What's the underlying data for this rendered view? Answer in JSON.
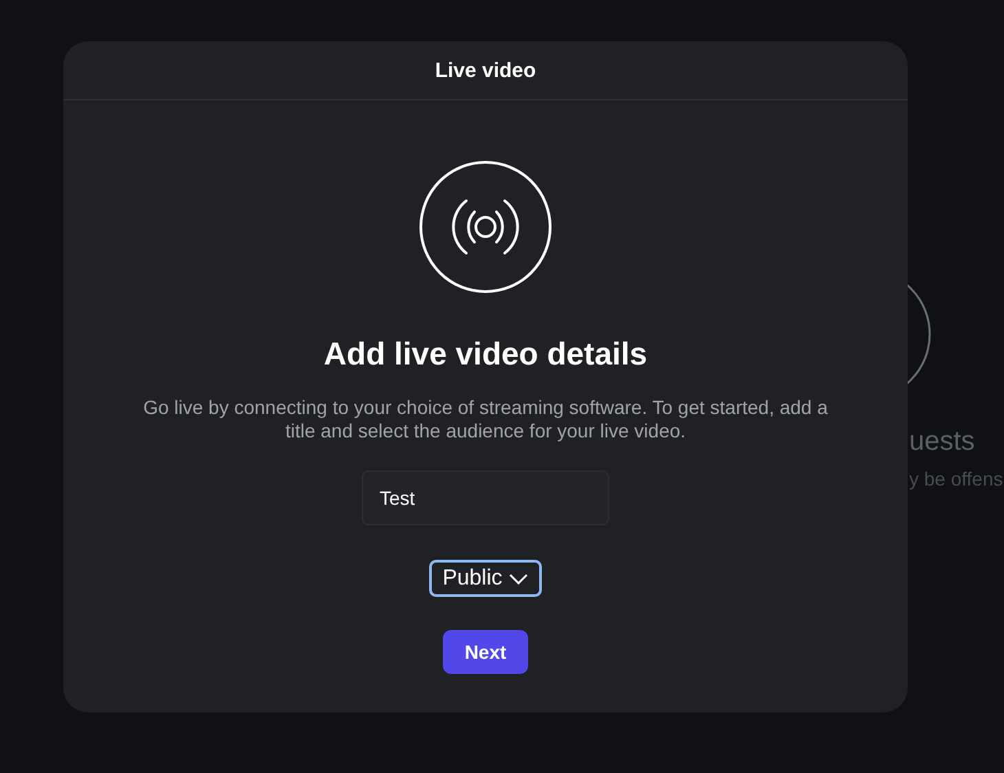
{
  "background": {
    "heading": "uests",
    "text": "y be offens"
  },
  "dialog": {
    "title": "Live video",
    "heading": "Add live video details",
    "description": "Go live by connecting to your choice of streaming software. To get started, add a title and select the audience for your live video.",
    "title_field": {
      "value": "Test"
    },
    "audience_select": {
      "value": "Public"
    },
    "buttons": [
      "Next"
    ]
  }
}
